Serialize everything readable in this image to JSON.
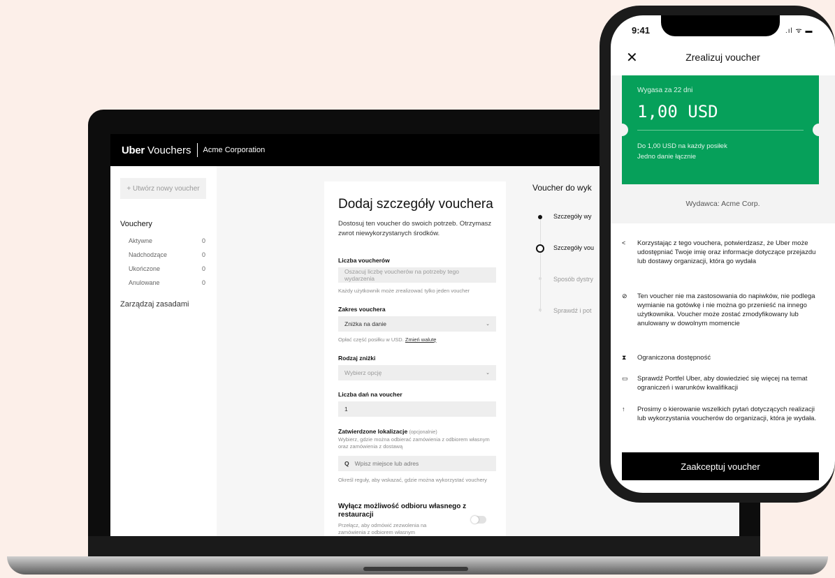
{
  "laptop": {
    "header": {
      "brand_bold": "Uber",
      "brand_light": "Vouchers",
      "org": "Acme Corporation"
    },
    "sidebar": {
      "create_button": "+ Utwórz nowy voucher",
      "section_title": "Vouchery",
      "items": [
        {
          "label": "Aktywne",
          "count": "0"
        },
        {
          "label": "Nadchodzące",
          "count": "0"
        },
        {
          "label": "Ukończone",
          "count": "0"
        },
        {
          "label": "Anulowane",
          "count": "0"
        }
      ],
      "manage": "Zarządzaj zasadami"
    },
    "form": {
      "title": "Dodaj szczegóły vouchera",
      "subtitle": "Dostosuj ten voucher do swoich potrzeb. Otrzymasz zwrot niewykorzystanych środków.",
      "count_label": "Liczba voucherów",
      "count_placeholder": "Oszacuj liczbę voucherów na potrzeby tego wydarzenia",
      "count_help": "Każdy użytkownik może zrealizować tylko jeden voucher",
      "scope_label": "Zakres vouchera",
      "scope_value": "Zniżka na danie",
      "scope_help_prefix": "Opłać część posiłku w USD.",
      "scope_help_link": "Zmień walutę",
      "discount_label": "Rodzaj zniżki",
      "discount_placeholder": "Wybierz opcję",
      "meals_label": "Liczba dań na voucher",
      "meals_value": "1",
      "locations_label": "Zatwierdzone lokalizacje",
      "locations_optional": "(opcjonalnie)",
      "locations_desc": "Wybierz, gdzie można odbierać zamówienia z odbiorem własnym oraz zamówienia z dostawą",
      "locations_placeholder": "Wpisz miejsce lub adres",
      "locations_help": "Określ reguły, aby wskazać, gdzie można wykorzystać vouchery",
      "pickup_title": "Wyłącz możliwość odbioru własnego z restauracji",
      "pickup_desc": "Przełącz, aby odmówić zezwolenia na zamówienia z odbiorem własnym"
    },
    "steps": {
      "title": "Voucher do wyk",
      "items": [
        "Szczegóły wy",
        "Szczegóły vou",
        "Sposób dystry",
        "Sprawdź i pot"
      ]
    }
  },
  "phone": {
    "time": "9:41",
    "status": ".ıl ᯤ ▬",
    "title": "Zrealizuj voucher",
    "expiry": "Wygasa za 22 dni",
    "amount": "1,00 USD",
    "line1": "Do 1,00 USD na każdy posiłek",
    "line2": "Jedno danie łącznie",
    "issuer": "Wydawca: Acme Corp.",
    "info": [
      {
        "icon": "share-icon",
        "glyph": "<",
        "text": "Korzystając z tego vouchera, potwierdzasz, że Uber może udostępniać Twoje imię oraz informacje dotyczące przejazdu lub dostawy organizacji, która go wydała"
      },
      {
        "icon": "prohibited-icon",
        "glyph": "⊘",
        "text": "Ten voucher nie ma zastosowania do napiwków, nie podlega wymianie na gotówkę i nie można go przenieść na innego użytkownika. Voucher może zostać zmodyfikowany lub anulowany w dowolnym momencie"
      },
      {
        "icon": "hourglass-icon",
        "glyph": "⧗",
        "text": "Ograniczona dostępność"
      },
      {
        "icon": "wallet-icon",
        "glyph": "▭",
        "text": "Sprawdź Portfel Uber, aby dowiedzieć się więcej na temat ograniczeń i warunków kwalifikacji"
      },
      {
        "icon": "arrow-up-icon",
        "glyph": "↑",
        "text": "Prosimy o kierowanie wszelkich pytań dotyczących realizacji lub wykorzystania voucherów do organizacji, która je wydała."
      }
    ],
    "accept_button": "Zaakceptuj voucher"
  },
  "colors": {
    "voucher_green": "#06a05a",
    "background": "#fcefe9"
  }
}
